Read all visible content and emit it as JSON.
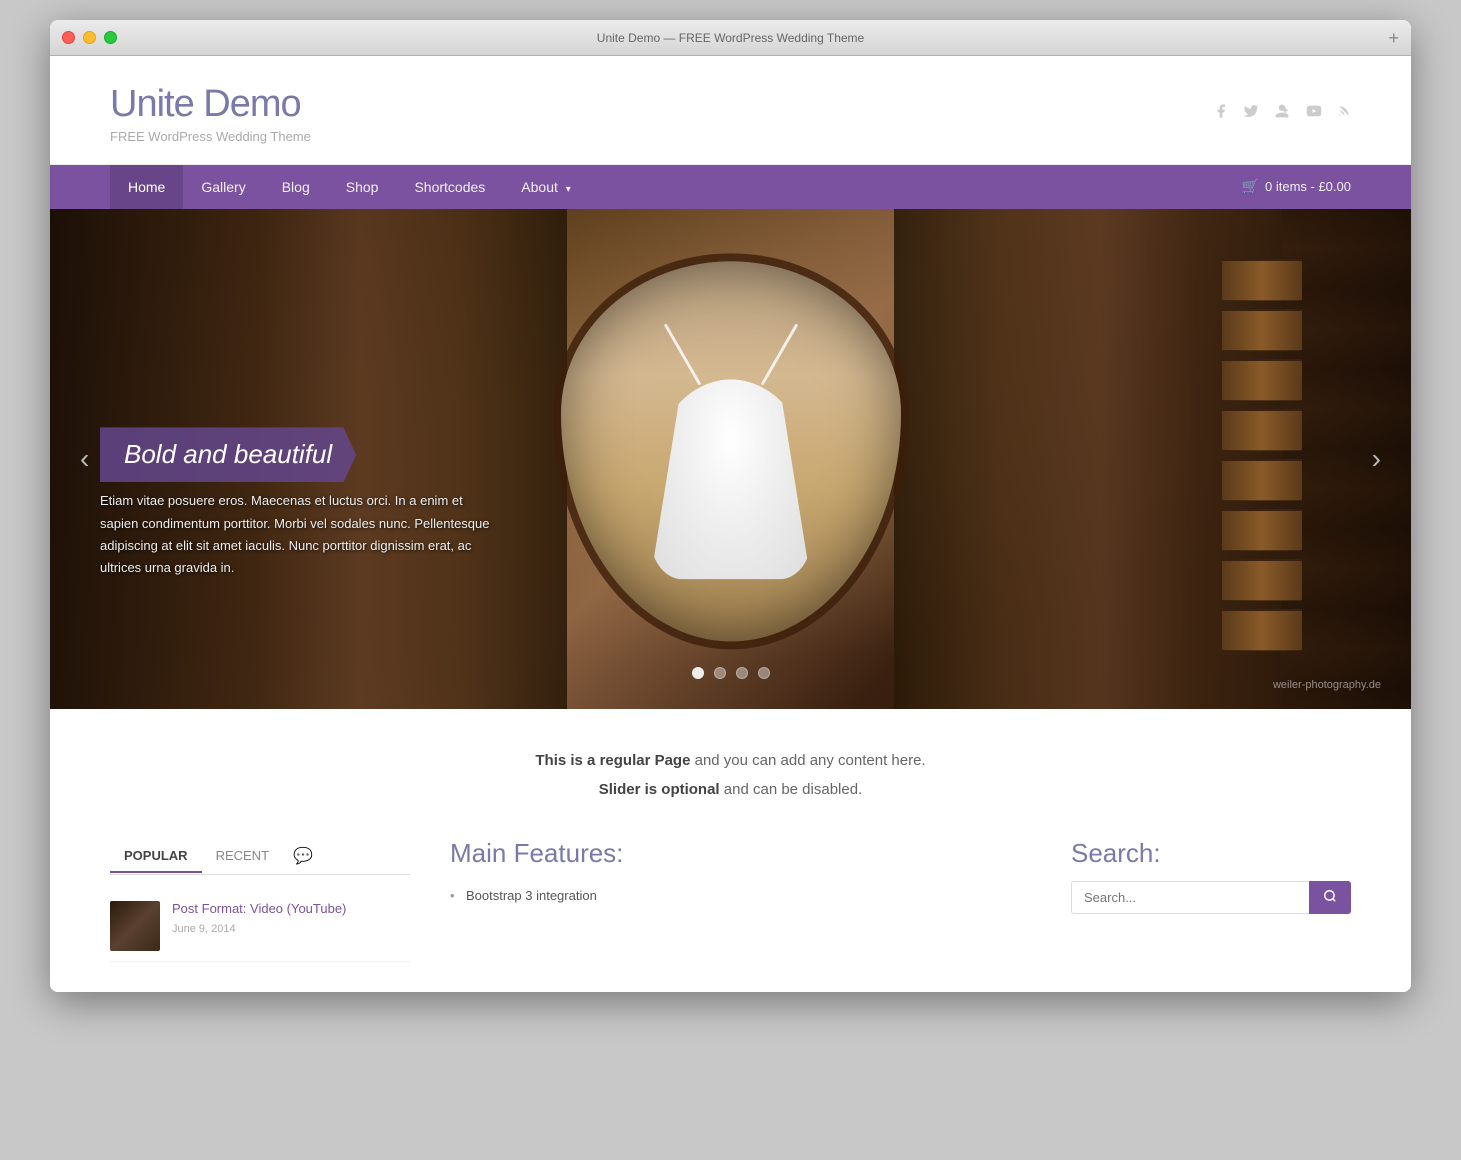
{
  "window": {
    "title": "Unite Demo — FREE WordPress Wedding Theme"
  },
  "header": {
    "site_title": "Unite Demo",
    "site_description": "FREE WordPress Wedding Theme",
    "social_icons": [
      {
        "name": "facebook-icon",
        "symbol": "f"
      },
      {
        "name": "twitter-icon",
        "symbol": "t"
      },
      {
        "name": "googleplus-icon",
        "symbol": "g+"
      },
      {
        "name": "youtube-icon",
        "symbol": "▶"
      },
      {
        "name": "rss-icon",
        "symbol": "◉"
      }
    ]
  },
  "nav": {
    "items": [
      {
        "label": "Home",
        "active": true
      },
      {
        "label": "Gallery",
        "active": false
      },
      {
        "label": "Blog",
        "active": false
      },
      {
        "label": "Shop",
        "active": false
      },
      {
        "label": "Shortcodes",
        "active": false
      },
      {
        "label": "About",
        "active": false,
        "has_dropdown": true
      }
    ],
    "cart_label": "0 items - £0.00"
  },
  "slider": {
    "title": "Bold and beautiful",
    "text": "Etiam vitae posuere eros. Maecenas et luctus orci. In a enim et sapien condimentum porttitor. Morbi vel sodales nunc. Pellentesque adipiscing at elit sit amet iaculis. Nunc porttitor dignissim erat, ac ultrices urna gravida in.",
    "prev_label": "‹",
    "next_label": "›",
    "photo_credit": "weiler-photography.de",
    "dots": [
      {
        "active": true
      },
      {
        "active": false
      },
      {
        "active": false
      },
      {
        "active": false
      }
    ]
  },
  "intro": {
    "line1_bold": "This is a regular Page",
    "line1_rest": " and you can add any content here.",
    "line2_bold": "Slider is optional",
    "line2_rest": " and can be disabled."
  },
  "tabs": {
    "items": [
      {
        "label": "POPULAR",
        "active": true
      },
      {
        "label": "RECENT",
        "active": false
      }
    ],
    "comment_icon": "💬"
  },
  "posts": [
    {
      "title": "Post Format: Video (YouTube)",
      "date": "June 9, 2014"
    }
  ],
  "features": {
    "title": "Main Features:",
    "items": [
      "Bootstrap 3 integration"
    ]
  },
  "search": {
    "title": "Search:",
    "placeholder": "Search...",
    "button_icon": "🔍"
  }
}
